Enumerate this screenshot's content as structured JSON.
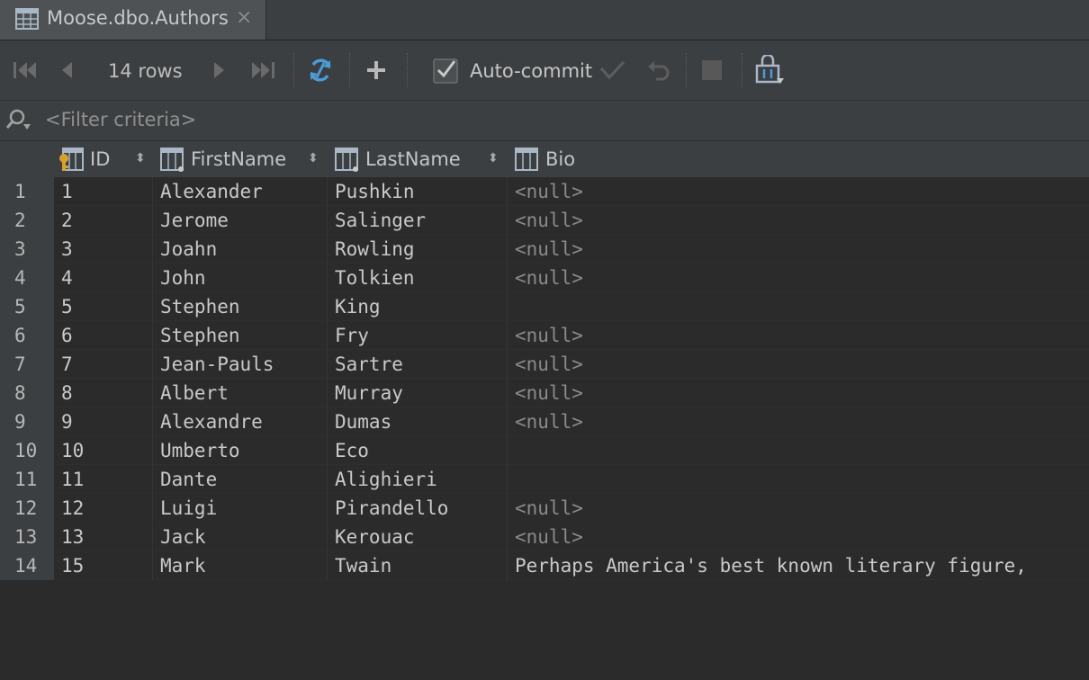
{
  "tab": {
    "title": "Moose.dbo.Authors",
    "close_glyph": "×"
  },
  "toolbar": {
    "rows_label": "14 rows",
    "autocommit_label": "Auto-commit",
    "autocommit_checked": true,
    "add_glyph": "+"
  },
  "filter": {
    "placeholder": "<Filter criteria>"
  },
  "columns": [
    {
      "name": "ID",
      "icon": "primary-key-column-icon"
    },
    {
      "name": "FirstName",
      "icon": "column-icon"
    },
    {
      "name": "LastName",
      "icon": "column-icon"
    },
    {
      "name": "Bio",
      "icon": "column-icon"
    }
  ],
  "sort_glyph": "⬍",
  "null_text": "<null>",
  "rows": [
    {
      "num": "1",
      "id": "1",
      "first": "Alexander",
      "last": "Pushkin",
      "bio": "<null>"
    },
    {
      "num": "2",
      "id": "2",
      "first": "Jerome",
      "last": "Salinger",
      "bio": "<null>"
    },
    {
      "num": "3",
      "id": "3",
      "first": "Joahn",
      "last": "Rowling",
      "bio": "<null>"
    },
    {
      "num": "4",
      "id": "4",
      "first": "John",
      "last": "Tolkien",
      "bio": "<null>"
    },
    {
      "num": "5",
      "id": "5",
      "first": "Stephen",
      "last": "King",
      "bio": ""
    },
    {
      "num": "6",
      "id": "6",
      "first": "Stephen",
      "last": "Fry",
      "bio": "<null>"
    },
    {
      "num": "7",
      "id": "7",
      "first": "Jean-Pauls",
      "last": "Sartre",
      "bio": "<null>"
    },
    {
      "num": "8",
      "id": "8",
      "first": "Albert",
      "last": "Murray",
      "bio": "<null>"
    },
    {
      "num": "9",
      "id": "9",
      "first": "Alexandre",
      "last": "Dumas",
      "bio": "<null>"
    },
    {
      "num": "10",
      "id": "10",
      "first": "Umberto",
      "last": "Eco",
      "bio": ""
    },
    {
      "num": "11",
      "id": "11",
      "first": "Dante",
      "last": "Alighieri",
      "bio": ""
    },
    {
      "num": "12",
      "id": "12",
      "first": "Luigi",
      "last": "Pirandello",
      "bio": "<null>"
    },
    {
      "num": "13",
      "id": "13",
      "first": "Jack",
      "last": "Kerouac",
      "bio": "<null>"
    },
    {
      "num": "14",
      "id": "15",
      "first": "Mark",
      "last": "Twain",
      "bio": "Perhaps America's best known literary figure,"
    }
  ],
  "colors": {
    "background": "#2b2b2b",
    "panel": "#3c3f41",
    "refresh_blue": "#4a9bd6",
    "key_gold": "#d8a02c"
  }
}
